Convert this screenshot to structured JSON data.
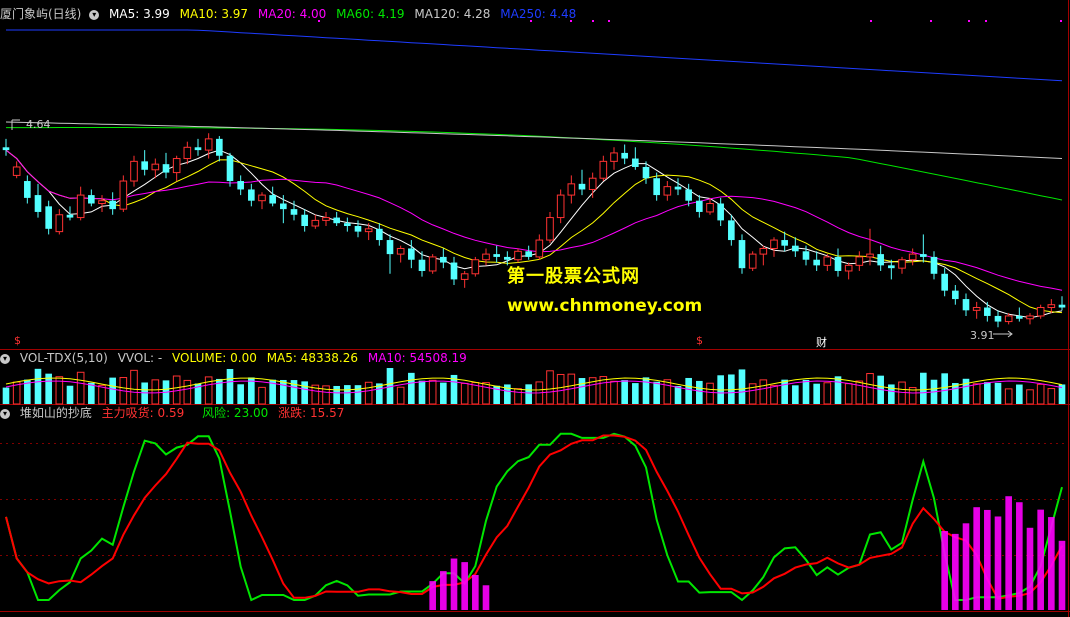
{
  "price_header": {
    "stock_title": "厦门象屿(日线)",
    "ma5": "MA5: 3.99",
    "ma10": "MA10: 3.97",
    "ma20": "MA20: 4.00",
    "ma60": "MA60: 4.19",
    "ma120": "MA120: 4.28",
    "ma250": "MA250: 4.48"
  },
  "price_annotations": {
    "high_label": "4.64",
    "low_label": "3.91",
    "marker_s1": "$",
    "marker_s2": "$",
    "marker_cai": "财"
  },
  "watermark": {
    "line1": "第一股票公式网",
    "line2": "www.chnmoney.com"
  },
  "volume_header": {
    "indicator": "VOL-TDX(5,10)",
    "vvol": "VVOL: -",
    "volume": "VOLUME: 0.00",
    "ma5": "MA5: 48338.26",
    "ma10": "MA10: 54508.19"
  },
  "indicator_header": {
    "name": "堆如山的抄底",
    "main_flow": "主力吸货: 0.59",
    "risk": "风险: 23.00",
    "change": "涨跌: 15.57"
  },
  "colors": {
    "up": "#ff3232",
    "down": "#54ffff",
    "ma5": "#ffffff",
    "ma10": "#ffff00",
    "ma20": "#ff00ff",
    "ma60": "#00e600",
    "ma120": "#c8c8c8",
    "ma250": "#1e3cff",
    "risk_line": "#00e600",
    "change_line": "#ff0000",
    "main_flow_bar": "#ff00ff"
  },
  "chart_data": {
    "type": "candlestick",
    "price_range": [
      3.9,
      4.64
    ],
    "candles": [
      [
        4.55,
        4.58,
        4.52,
        4.54
      ],
      [
        4.45,
        4.5,
        4.44,
        4.48
      ],
      [
        4.43,
        4.45,
        4.35,
        4.37
      ],
      [
        4.38,
        4.42,
        4.3,
        4.32
      ],
      [
        4.34,
        4.36,
        4.24,
        4.26
      ],
      [
        4.25,
        4.33,
        4.24,
        4.31
      ],
      [
        4.31,
        4.34,
        4.29,
        4.3
      ],
      [
        4.3,
        4.41,
        4.29,
        4.38
      ],
      [
        4.38,
        4.4,
        4.34,
        4.35
      ],
      [
        4.35,
        4.38,
        4.32,
        4.36
      ],
      [
        4.36,
        4.39,
        4.31,
        4.33
      ],
      [
        4.33,
        4.45,
        4.32,
        4.43
      ],
      [
        4.43,
        4.52,
        4.41,
        4.5
      ],
      [
        4.5,
        4.54,
        4.45,
        4.47
      ],
      [
        4.47,
        4.51,
        4.44,
        4.49
      ],
      [
        4.49,
        4.53,
        4.44,
        4.46
      ],
      [
        4.46,
        4.52,
        4.43,
        4.51
      ],
      [
        4.51,
        4.57,
        4.49,
        4.55
      ],
      [
        4.55,
        4.58,
        4.52,
        4.54
      ],
      [
        4.54,
        4.6,
        4.51,
        4.58
      ],
      [
        4.58,
        4.59,
        4.5,
        4.52
      ],
      [
        4.52,
        4.53,
        4.41,
        4.43
      ],
      [
        4.43,
        4.45,
        4.38,
        4.4
      ],
      [
        4.4,
        4.42,
        4.34,
        4.36
      ],
      [
        4.36,
        4.39,
        4.33,
        4.38
      ],
      [
        4.38,
        4.41,
        4.34,
        4.35
      ],
      [
        4.35,
        4.38,
        4.28,
        4.33
      ],
      [
        4.33,
        4.36,
        4.29,
        4.31
      ],
      [
        4.31,
        4.33,
        4.25,
        4.27
      ],
      [
        4.27,
        4.31,
        4.26,
        4.29
      ],
      [
        4.29,
        4.32,
        4.27,
        4.3
      ],
      [
        4.3,
        4.32,
        4.27,
        4.28
      ],
      [
        4.28,
        4.3,
        4.25,
        4.27
      ],
      [
        4.27,
        4.29,
        4.23,
        4.25
      ],
      [
        4.25,
        4.28,
        4.22,
        4.26
      ],
      [
        4.26,
        4.28,
        4.2,
        4.22
      ],
      [
        4.22,
        4.24,
        4.1,
        4.17
      ],
      [
        4.17,
        4.2,
        4.14,
        4.19
      ],
      [
        4.19,
        4.22,
        4.12,
        4.15
      ],
      [
        4.15,
        4.18,
        4.09,
        4.11
      ],
      [
        4.11,
        4.17,
        4.1,
        4.16
      ],
      [
        4.16,
        4.19,
        4.12,
        4.14
      ],
      [
        4.14,
        4.16,
        4.06,
        4.08
      ],
      [
        4.08,
        4.11,
        4.05,
        4.1
      ],
      [
        4.1,
        4.16,
        4.09,
        4.15
      ],
      [
        4.15,
        4.19,
        4.13,
        4.17
      ],
      [
        4.17,
        4.2,
        4.14,
        4.16
      ],
      [
        4.16,
        4.18,
        4.13,
        4.15
      ],
      [
        4.15,
        4.19,
        4.14,
        4.18
      ],
      [
        4.18,
        4.2,
        4.15,
        4.16
      ],
      [
        4.16,
        4.24,
        4.15,
        4.22
      ],
      [
        4.22,
        4.32,
        4.21,
        4.3
      ],
      [
        4.3,
        4.4,
        4.28,
        4.38
      ],
      [
        4.38,
        4.45,
        4.35,
        4.42
      ],
      [
        4.42,
        4.47,
        4.38,
        4.4
      ],
      [
        4.4,
        4.46,
        4.37,
        4.44
      ],
      [
        4.44,
        4.52,
        4.43,
        4.5
      ],
      [
        4.5,
        4.55,
        4.47,
        4.53
      ],
      [
        4.53,
        4.56,
        4.49,
        4.51
      ],
      [
        4.51,
        4.55,
        4.47,
        4.48
      ],
      [
        4.48,
        4.5,
        4.42,
        4.44
      ],
      [
        4.44,
        4.46,
        4.36,
        4.38
      ],
      [
        4.38,
        4.43,
        4.36,
        4.41
      ],
      [
        4.41,
        4.44,
        4.38,
        4.4
      ],
      [
        4.4,
        4.42,
        4.34,
        4.36
      ],
      [
        4.36,
        4.38,
        4.3,
        4.32
      ],
      [
        4.32,
        4.37,
        4.31,
        4.35
      ],
      [
        4.35,
        4.37,
        4.27,
        4.29
      ],
      [
        4.29,
        4.31,
        4.2,
        4.22
      ],
      [
        4.22,
        4.24,
        4.1,
        4.12
      ],
      [
        4.12,
        4.18,
        4.11,
        4.17
      ],
      [
        4.17,
        4.2,
        4.13,
        4.19
      ],
      [
        4.19,
        4.23,
        4.16,
        4.22
      ],
      [
        4.22,
        4.25,
        4.18,
        4.2
      ],
      [
        4.2,
        4.23,
        4.16,
        4.18
      ],
      [
        4.18,
        4.2,
        4.13,
        4.15
      ],
      [
        4.15,
        4.18,
        4.11,
        4.13
      ],
      [
        4.13,
        4.17,
        4.11,
        4.16
      ],
      [
        4.16,
        4.19,
        4.09,
        4.11
      ],
      [
        4.11,
        4.14,
        4.08,
        4.13
      ],
      [
        4.13,
        4.18,
        4.11,
        4.16
      ],
      [
        4.16,
        4.26,
        4.13,
        4.17
      ],
      [
        4.17,
        4.2,
        4.11,
        4.13
      ],
      [
        4.13,
        4.15,
        4.08,
        4.12
      ],
      [
        4.12,
        4.16,
        4.1,
        4.15
      ],
      [
        4.15,
        4.19,
        4.13,
        4.17
      ],
      [
        4.17,
        4.24,
        4.14,
        4.16
      ],
      [
        4.16,
        4.18,
        4.08,
        4.1
      ],
      [
        4.1,
        4.12,
        4.02,
        4.04
      ],
      [
        4.04,
        4.06,
        3.99,
        4.01
      ],
      [
        4.01,
        4.03,
        3.95,
        3.97
      ],
      [
        3.97,
        4.0,
        3.94,
        3.98
      ],
      [
        3.98,
        4.0,
        3.93,
        3.95
      ],
      [
        3.95,
        3.97,
        3.91,
        3.93
      ],
      [
        3.93,
        3.96,
        3.92,
        3.95
      ],
      [
        3.95,
        3.98,
        3.93,
        3.94
      ],
      [
        3.94,
        3.96,
        3.92,
        3.95
      ],
      [
        3.95,
        3.99,
        3.94,
        3.98
      ],
      [
        3.98,
        4.01,
        3.96,
        3.99
      ],
      [
        3.99,
        4.02,
        3.97,
        3.98
      ]
    ]
  }
}
